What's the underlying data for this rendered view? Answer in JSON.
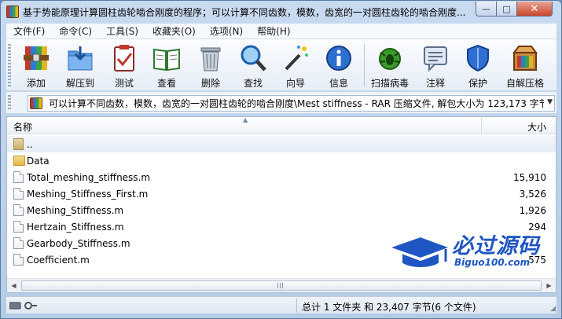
{
  "window": {
    "title": "基于势能原理计算圆柱齿轮啮合刚度的程序；可以计算不同齿数，模数，齿宽的一对圆柱齿轮的啮合刚度...",
    "controls": {
      "minimize": "—",
      "maximize": "□",
      "close": "✕"
    }
  },
  "menu": [
    "文件(F)",
    "命令(C)",
    "工具(S)",
    "收藏夹(O)",
    "选项(N)",
    "帮助(H)"
  ],
  "toolbar": [
    {
      "label": "添加",
      "icon": "add-archive-icon"
    },
    {
      "label": "解压到",
      "icon": "extract-to-icon"
    },
    {
      "label": "测试",
      "icon": "test-icon"
    },
    {
      "label": "查看",
      "icon": "view-icon"
    },
    {
      "label": "删除",
      "icon": "delete-icon"
    },
    {
      "label": "查找",
      "icon": "find-icon"
    },
    {
      "label": "向导",
      "icon": "wizard-icon"
    },
    {
      "label": "信息",
      "icon": "info-icon"
    },
    {
      "label": "扫描病毒",
      "icon": "virus-scan-icon"
    },
    {
      "label": "注释",
      "icon": "comment-icon"
    },
    {
      "label": "保护",
      "icon": "protect-icon"
    },
    {
      "label": "自解压格",
      "icon": "sfx-icon"
    }
  ],
  "address": {
    "path": "可以计算不同齿数，模数，齿宽的一对圆柱齿轮的啮合刚度\\Mest stiffness - RAR 压缩文件, 解包大小为 123,173 字节"
  },
  "list": {
    "columns": {
      "name": "名称",
      "size": "大小"
    },
    "rows": [
      {
        "name": "..",
        "size": "",
        "type": "up"
      },
      {
        "name": "Data",
        "size": "",
        "type": "folder"
      },
      {
        "name": "Total_meshing_stiffness.m",
        "size": "15,910",
        "type": "file"
      },
      {
        "name": "Meshing_Stiffness_First.m",
        "size": "3,526",
        "type": "file"
      },
      {
        "name": "Meshing_Stiffness.m",
        "size": "1,926",
        "type": "file"
      },
      {
        "name": "Hertzain_Stiffness.m",
        "size": "294",
        "type": "file"
      },
      {
        "name": "Gearbody_Stiffness.m",
        "size": "",
        "type": "file"
      },
      {
        "name": "Coefficient.m",
        "size": "575",
        "type": "file"
      }
    ]
  },
  "watermark": {
    "big": "必过源码",
    "small": "Biguo100.com"
  },
  "status": {
    "summary": "总计 1 文件夹 和 23,407 字节(6 个文件)"
  },
  "colors": {
    "accent": "#1f56c2",
    "selection": "#e6edf6"
  }
}
